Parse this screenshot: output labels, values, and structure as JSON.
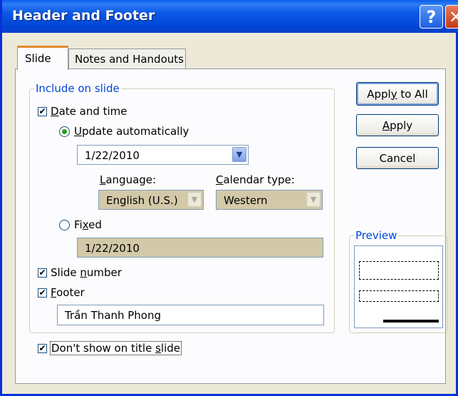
{
  "window": {
    "title": "Header and Footer",
    "help_label": "?",
    "close_label": "✕"
  },
  "tabs": [
    {
      "label": "Slide"
    },
    {
      "label": "Notes and Handouts"
    }
  ],
  "include_group": {
    "label": "Include on slide"
  },
  "date_time": {
    "label_pre": "",
    "label_key": "D",
    "label_post": "ate and time",
    "checked": true,
    "update_auto": {
      "pre": "",
      "key": "U",
      "post": "pdate automatically",
      "selected": true
    },
    "date_value": "1/22/2010",
    "language": {
      "pre": "",
      "key": "L",
      "post": "anguage:",
      "value": "English (U.S.)"
    },
    "calendar": {
      "pre": "",
      "key": "C",
      "post": "alendar type:",
      "value": "Western"
    },
    "fixed": {
      "pre": "Fi",
      "key": "x",
      "post": "ed",
      "selected": false
    },
    "fixed_value": "1/22/2010"
  },
  "slide_number": {
    "pre": "Slide ",
    "key": "n",
    "post": "umber",
    "checked": true
  },
  "footer": {
    "pre": "",
    "key": "F",
    "post": "ooter",
    "checked": true,
    "value": "Trần Thanh Phong"
  },
  "dont_show": {
    "pre": "Don't show on title ",
    "key": "s",
    "post": "lide",
    "checked": true
  },
  "buttons": {
    "apply_all": {
      "pre": "Appl",
      "key": "y",
      "post": " to All"
    },
    "apply": {
      "pre": "",
      "key": "A",
      "post": "pply"
    },
    "cancel": {
      "label": "Cancel"
    }
  },
  "preview": {
    "label": "Preview"
  },
  "icons": {
    "check": "✔",
    "dropdown": "▼"
  }
}
